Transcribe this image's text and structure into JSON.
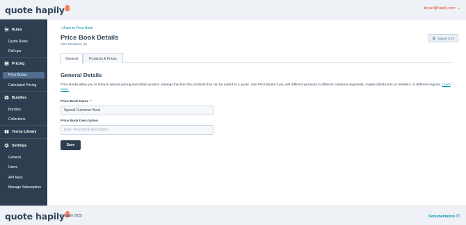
{
  "brand": {
    "logo_word1": "quote",
    "logo_word2": "hapily"
  },
  "header": {
    "user_email": "bryan@hapily.com",
    "user_menu_chevron": "⌄"
  },
  "sidebar": {
    "sections": [
      {
        "title": "Rules",
        "icon": "sliders-icon",
        "items": [
          {
            "label": "Quote Rules",
            "active": false
          },
          {
            "label": "Roll-ups",
            "active": false
          }
        ]
      },
      {
        "title": "Pricing",
        "icon": "price-tag-icon",
        "items": [
          {
            "label": "Price Books",
            "active": true
          },
          {
            "label": "Calculated Pricing",
            "active": false
          }
        ]
      },
      {
        "title": "Bundles",
        "icon": "box-icon",
        "items": [
          {
            "label": "Bundles",
            "active": false
          },
          {
            "label": "Collections",
            "active": false
          }
        ]
      },
      {
        "title": "Terms Library",
        "icon": "book-icon",
        "items": []
      },
      {
        "title": "Settings",
        "icon": "gear-icon",
        "items": [
          {
            "label": "General",
            "active": false
          },
          {
            "label": "Users",
            "active": false
          },
          {
            "label": "API Keys",
            "active": false
          },
          {
            "label": "Manage Subscription",
            "active": false
          }
        ]
      }
    ],
    "active_bg": "#516f90",
    "bg": "#2e3e50"
  },
  "main": {
    "back_link": "< Back to Price Book",
    "title": "Price Book Details",
    "subtitle": "USA Pricebook (2)",
    "export_button": "Export CSV",
    "tabs": [
      {
        "label": "General",
        "active": true
      },
      {
        "label": "Products & Prices",
        "active": false
      }
    ],
    "section_title": "General Details",
    "description": "Price Books allow you to enforce special pricing and define product catalogs that limit the products that can be added to a quote. Use Price Books if you sell different products to different customer segments, maybe distributors vs resellers, or different regions.",
    "learn_more": "Learn more.",
    "name_label": "Price Book Name",
    "required_marker": "*",
    "name_value": "Special Customer Book",
    "desc_label": "Price Book Description",
    "desc_placeholder": "Enter Price Book description",
    "save_button": "Save"
  },
  "footer": {
    "copyright": "© hapily 2025",
    "documentation": "Documentation"
  },
  "colors": {
    "accent": "#0091ae",
    "brand_orange": "#ff7a59",
    "dark": "#2e3e50"
  }
}
